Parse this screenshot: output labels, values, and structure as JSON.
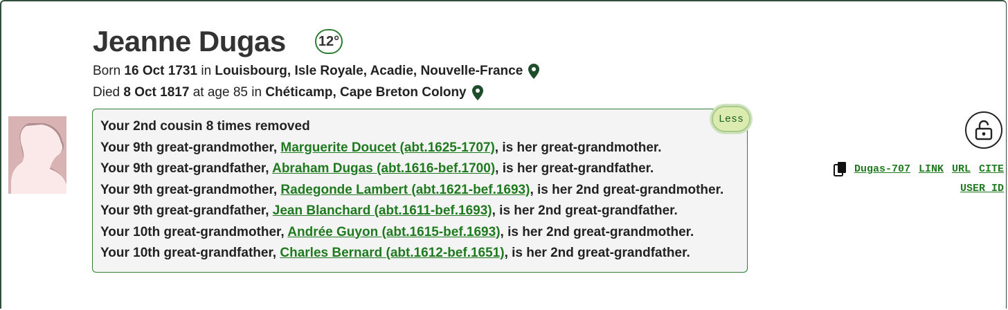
{
  "profile": {
    "name": "Jeanne Dugas",
    "degree": "12°",
    "born": {
      "prefix": "Born",
      "date": "16 Oct 1731",
      "in": "in",
      "place": "Louisbourg, Isle Royale, Acadie, Nouvelle-France"
    },
    "died": {
      "prefix": "Died",
      "date": "8 Oct 1817",
      "age_text": "at age 85 in",
      "place": "Chéticamp, Cape Breton Colony"
    }
  },
  "relationship": {
    "summary": "Your 2nd cousin 8 times removed",
    "toggle_label": "Less",
    "lines": [
      {
        "prefix": "Your 9th great-grandmother,",
        "link": "Marguerite Doucet (abt.1625-1707)",
        "suffix": ", is her great-grandmother."
      },
      {
        "prefix": "Your 9th great-grandfather,",
        "link": "Abraham Dugas (abt.1616-bef.1700)",
        "suffix": ", is her great-grandfather."
      },
      {
        "prefix": "Your 9th great-grandmother,",
        "link": "Radegonde Lambert (abt.1621-bef.1693)",
        "suffix": ", is her 2nd great-grandmother."
      },
      {
        "prefix": "Your 9th great-grandfather,",
        "link": "Jean Blanchard (abt.1611-bef.1693)",
        "suffix": ", is her 2nd great-grandfather."
      },
      {
        "prefix": "Your 10th great-grandmother,",
        "link": "Andrée Guyon (abt.1615-bef.1693)",
        "suffix": ", is her 2nd great-grandmother."
      },
      {
        "prefix": "Your 10th great-grandfather,",
        "link": "Charles Bernard (abt.1612-bef.1651)",
        "suffix": ", is her 2nd great-grandfather."
      }
    ]
  },
  "actions": {
    "profile_id": "Dugas-707",
    "link": "LINK",
    "url": "URL",
    "cite": "CITE",
    "user_id": "USER ID"
  },
  "icons": {
    "lock": "unlock-icon",
    "copy": "copy-icon",
    "pin": "map-pin-icon",
    "avatar": "female-silhouette"
  },
  "colors": {
    "link": "#1f7a1f",
    "accent": "#2e7d32",
    "less_button": "#dcecb0",
    "avatar_bg": "#d9b2b4"
  }
}
